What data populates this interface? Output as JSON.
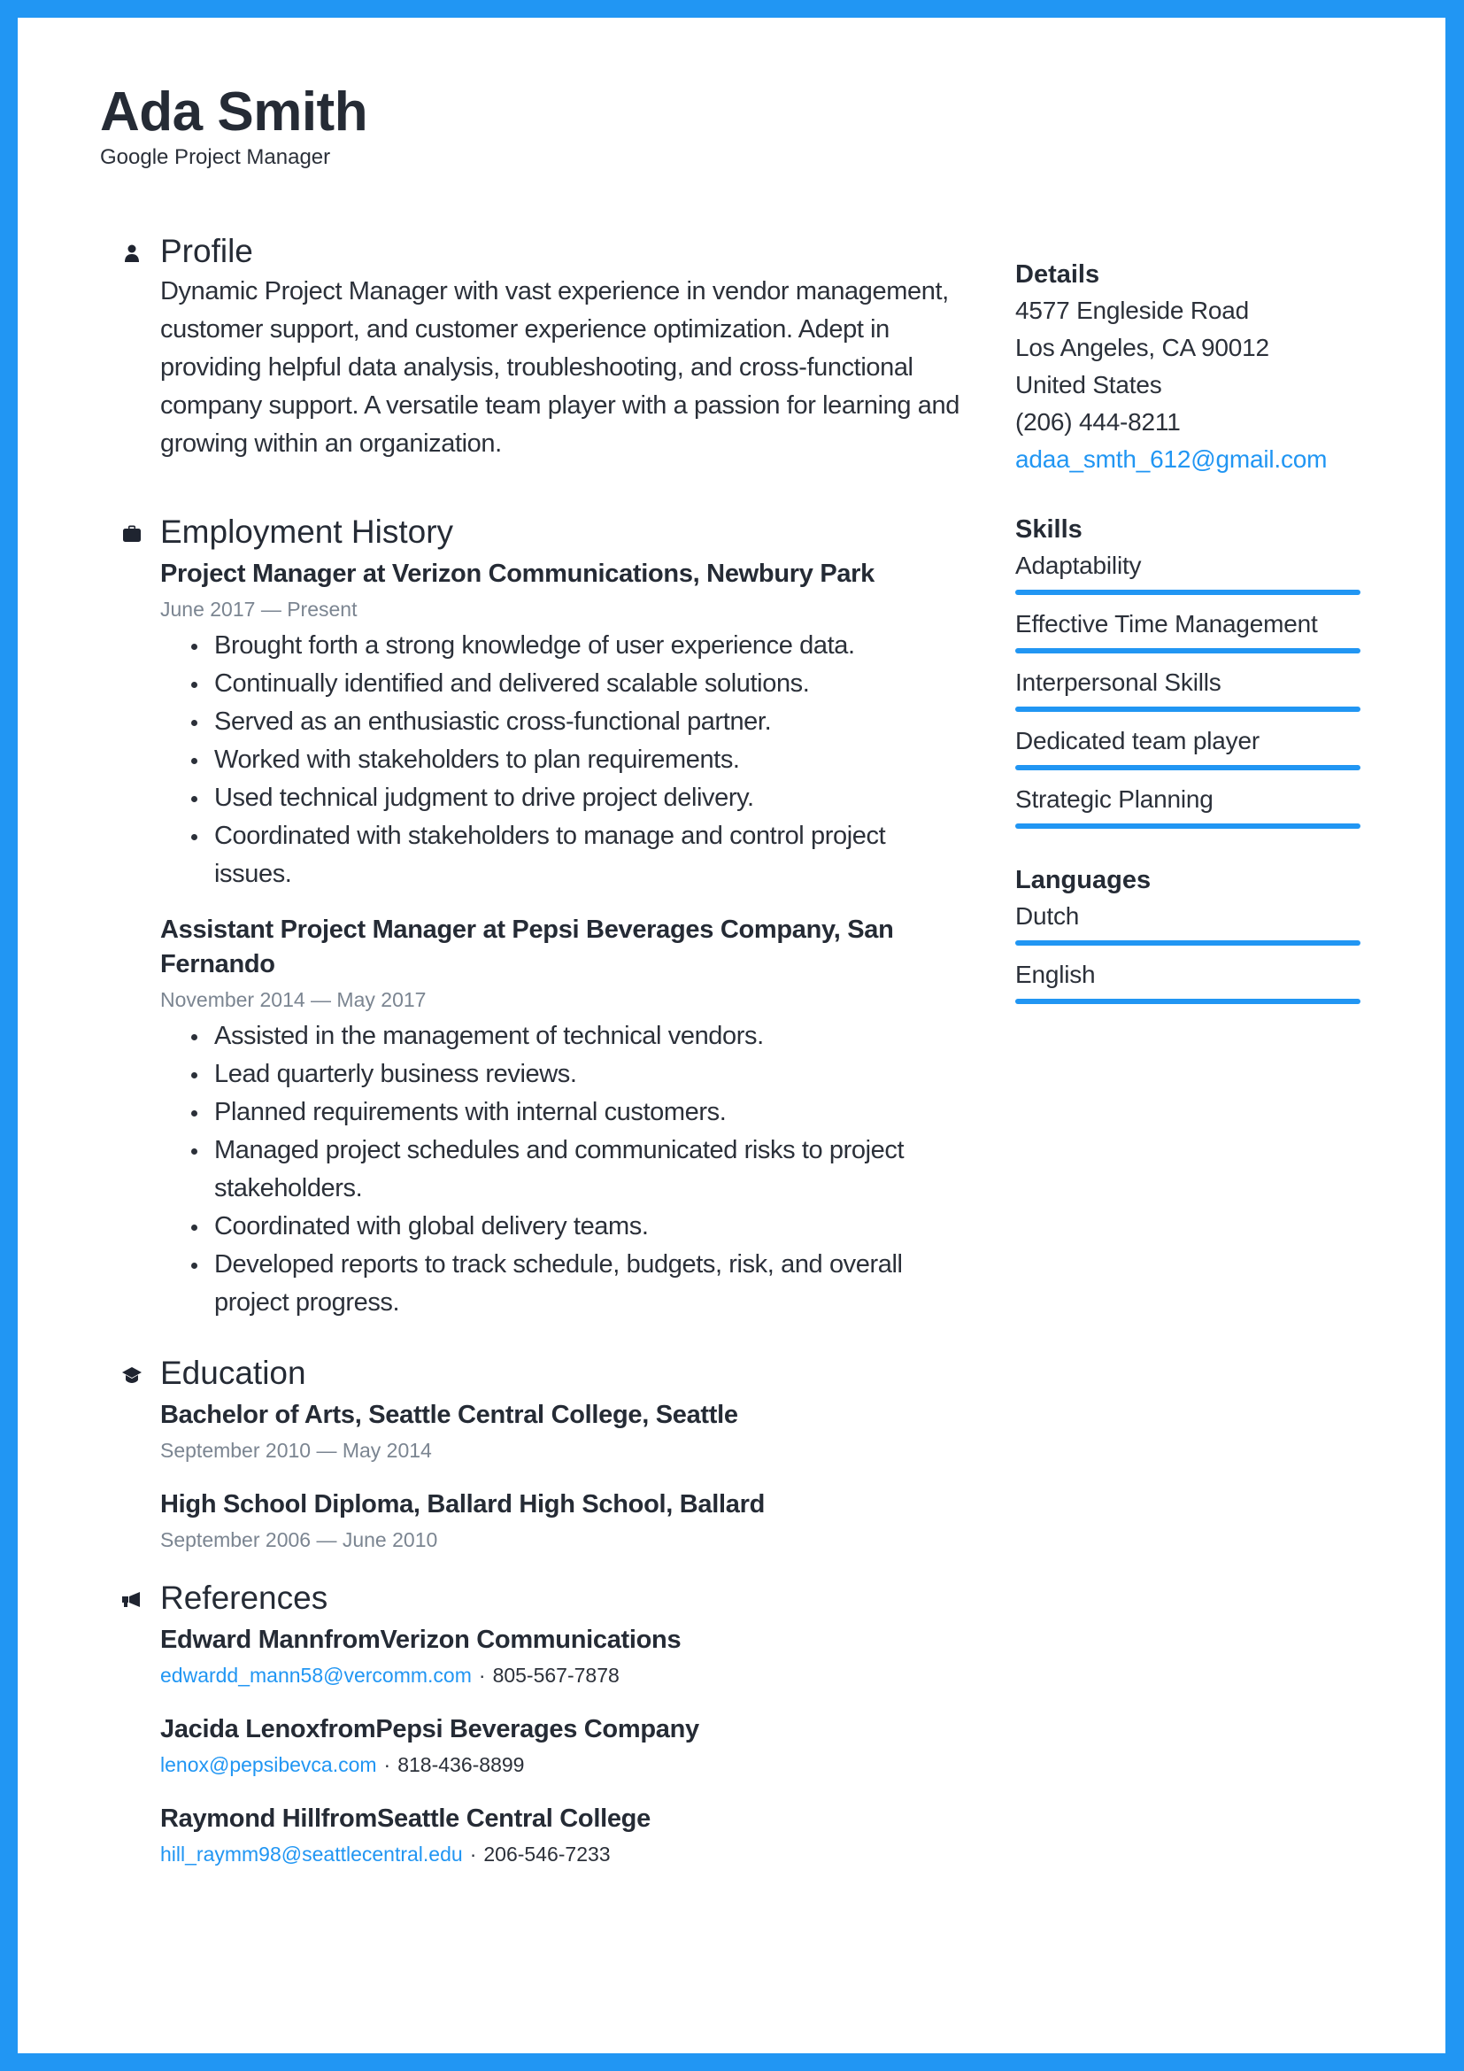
{
  "colors": {
    "accent": "#2196f3",
    "text": "#252b35",
    "muted": "#7b8591"
  },
  "header": {
    "name": "Ada Smith",
    "title": "Google Project Manager"
  },
  "profile": {
    "title": "Profile",
    "icon": "person-icon",
    "text": "Dynamic Project Manager with vast experience in vendor management, customer support, and customer experience optimization. Adept in providing helpful data analysis, troubleshooting, and cross-functional company support. A versatile team player with a passion for learning and growing within an organization."
  },
  "employment": {
    "title": "Employment History",
    "icon": "briefcase-icon",
    "jobs": [
      {
        "heading": "Project Manager at Verizon Communications, Newbury Park",
        "dates": "June 2017 — Present",
        "bullets": [
          "Brought forth a strong knowledge of user experience data.",
          "Continually identified and delivered scalable solutions.",
          "Served as an enthusiastic cross-functional partner.",
          "Worked with stakeholders to plan requirements.",
          "Used technical judgment to drive project delivery.",
          "Coordinated with stakeholders to manage and control project issues."
        ]
      },
      {
        "heading": "Assistant Project Manager at Pepsi Beverages Company, San Fernando",
        "dates": "November 2014 — May 2017",
        "bullets": [
          "Assisted in the management of technical vendors.",
          "Lead quarterly business reviews.",
          "Planned requirements with internal customers.",
          "Managed project schedules and communicated risks to project stakeholders.",
          "Coordinated with global delivery teams.",
          "Developed reports to track schedule, budgets, risk, and overall project progress."
        ]
      }
    ]
  },
  "education": {
    "title": "Education",
    "icon": "graduation-cap-icon",
    "items": [
      {
        "heading": "Bachelor of Arts, Seattle Central College, Seattle",
        "dates": "September 2010 — May 2014"
      },
      {
        "heading": "High School Diploma, Ballard High School, Ballard",
        "dates": "September 2006 — June 2010"
      }
    ]
  },
  "references": {
    "title": "References",
    "icon": "megaphone-icon",
    "separator": "·",
    "items": [
      {
        "heading": "Edward MannfromVerizon Communications",
        "email": "edwardd_mann58@vercomm.com",
        "phone": "805-567-7878"
      },
      {
        "heading": "Jacida LenoxfromPepsi Beverages Company",
        "email": "lenox@pepsibevca.com",
        "phone": "818-436-8899"
      },
      {
        "heading": "Raymond HillfromSeattle Central College",
        "email": "hill_raymm98@seattlecentral.edu",
        "phone": "206-546-7233"
      }
    ]
  },
  "sidebar": {
    "details": {
      "title": "Details",
      "address_line1": "4577 Engleside Road",
      "address_line2": "Los Angeles, CA 90012",
      "country": "United States",
      "phone": "(206) 444-8211",
      "email": "adaa_smth_612@gmail.com"
    },
    "skills": {
      "title": "Skills",
      "items": [
        {
          "label": "Adaptability",
          "level": 1.0
        },
        {
          "label": "Effective Time Management",
          "level": 1.0
        },
        {
          "label": "Interpersonal Skills",
          "level": 1.0
        },
        {
          "label": "Dedicated team player",
          "level": 1.0
        },
        {
          "label": "Strategic Planning",
          "level": 1.0
        }
      ]
    },
    "languages": {
      "title": "Languages",
      "items": [
        {
          "label": "Dutch",
          "level": 1.0
        },
        {
          "label": "English",
          "level": 1.0
        }
      ]
    }
  }
}
